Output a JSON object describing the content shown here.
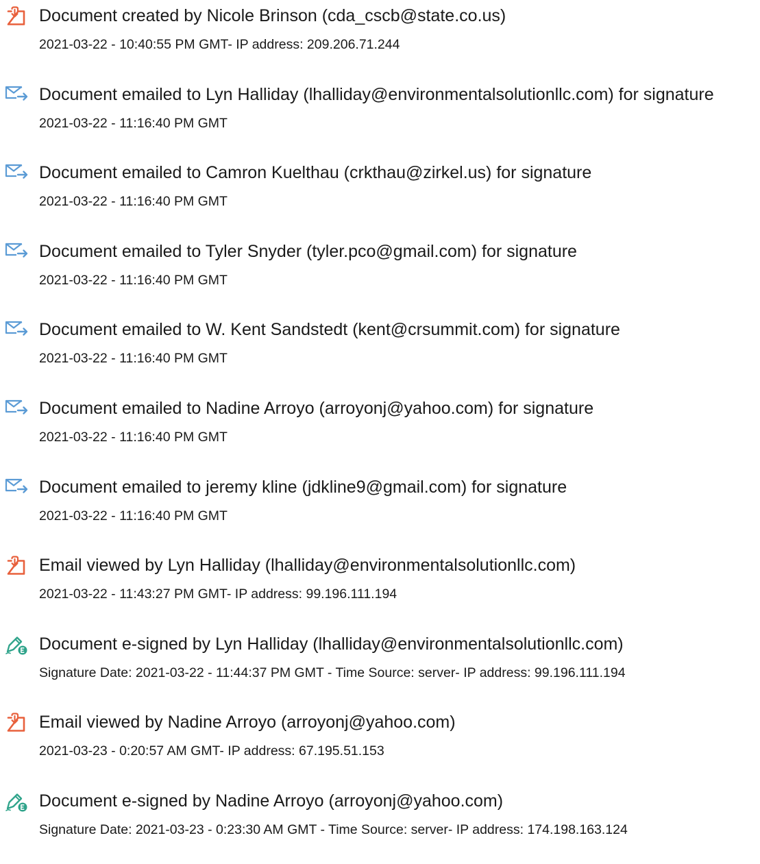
{
  "colors": {
    "doc_icon": "#e8603c",
    "email_icon": "#5b9bd5",
    "esign_icon": "#2ea38a",
    "text": "#1a1a1a"
  },
  "events": [
    {
      "icon": "document-icon",
      "title": "Document created by Nicole Brinson (cda_cscb@state.co.us)",
      "detail": "2021-03-22 - 10:40:55 PM GMT- IP address: 209.206.71.244"
    },
    {
      "icon": "email-sent-icon",
      "title": "Document emailed to Lyn Halliday (lhalliday@environmentalsolutionllc.com) for signature",
      "detail": "2021-03-22 - 11:16:40 PM GMT"
    },
    {
      "icon": "email-sent-icon",
      "title": "Document emailed to Camron Kuelthau (crkthau@zirkel.us) for signature",
      "detail": "2021-03-22 - 11:16:40 PM GMT"
    },
    {
      "icon": "email-sent-icon",
      "title": "Document emailed to Tyler Snyder (tyler.pco@gmail.com) for signature",
      "detail": "2021-03-22 - 11:16:40 PM GMT"
    },
    {
      "icon": "email-sent-icon",
      "title": "Document emailed to W. Kent Sandstedt (kent@crsummit.com) for signature",
      "detail": "2021-03-22 - 11:16:40 PM GMT"
    },
    {
      "icon": "email-sent-icon",
      "title": "Document emailed to Nadine Arroyo (arroyonj@yahoo.com) for signature",
      "detail": "2021-03-22 - 11:16:40 PM GMT"
    },
    {
      "icon": "email-sent-icon",
      "title": "Document emailed to jeremy kline (jdkline9@gmail.com) for signature",
      "detail": "2021-03-22 - 11:16:40 PM GMT"
    },
    {
      "icon": "document-icon",
      "title": "Email viewed by Lyn Halliday (lhalliday@environmentalsolutionllc.com)",
      "detail": "2021-03-22 - 11:43:27 PM GMT- IP address: 99.196.111.194"
    },
    {
      "icon": "esign-icon",
      "title": "Document e-signed by Lyn Halliday (lhalliday@environmentalsolutionllc.com)",
      "detail": "Signature Date: 2021-03-22 - 11:44:37 PM GMT - Time Source: server- IP address: 99.196.111.194"
    },
    {
      "icon": "document-icon",
      "title": "Email viewed by Nadine Arroyo (arroyonj@yahoo.com)",
      "detail": "2021-03-23 - 0:20:57 AM GMT- IP address: 67.195.51.153"
    },
    {
      "icon": "esign-icon",
      "title": "Document e-signed by Nadine Arroyo (arroyonj@yahoo.com)",
      "detail": "Signature Date: 2021-03-23 - 0:23:30 AM GMT - Time Source: server- IP address: 174.198.163.124"
    }
  ]
}
